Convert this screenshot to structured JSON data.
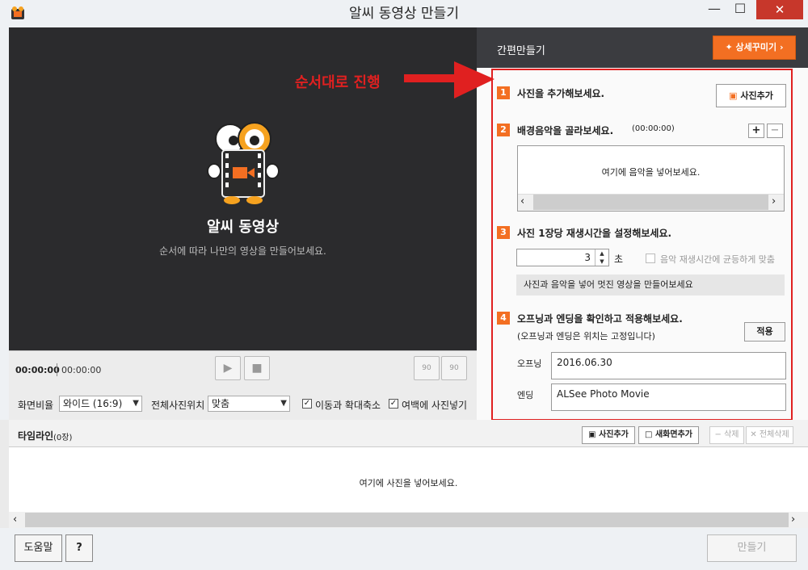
{
  "window": {
    "title": "알씨 동영상 만들기",
    "min": "—",
    "max": "☐",
    "close": "✕"
  },
  "preview": {
    "title": "알씨 동영상",
    "subtitle": "순서에 따라 나만의 영상을 만들어보세요."
  },
  "player": {
    "current_time": "00:00:00",
    "total_time": "00:00:00",
    "rotate_left": "90",
    "rotate_right": "90"
  },
  "options": {
    "ratio_label": "화면비율",
    "ratio_value": "와이드 (16:9)",
    "position_label": "전체사진위치",
    "position_value": "맞춤",
    "zoom_label": "이동과 확대축소",
    "zoom_checked": true,
    "margin_label": "여백에 사진넣기",
    "margin_checked": true
  },
  "panel": {
    "title": "간편만들기",
    "detail_button": "상세꾸미기"
  },
  "annotation": {
    "text": "순서대로 진행"
  },
  "steps": {
    "s1": {
      "num": "1",
      "title": "사진을 추가해보세요.",
      "button": "사진추가"
    },
    "s2": {
      "num": "2",
      "title": "배경음악을 골라보세요.",
      "time": "(00:00:00)",
      "add": "+",
      "remove": "−",
      "placeholder": "여기에 음악을 넣어보세요."
    },
    "s3": {
      "num": "3",
      "title": "사진 1장당 재생시간을 설정해보세요.",
      "seconds": "3",
      "unit": "초",
      "equal_label": "음악 재생시간에 균등하게 맞춤",
      "hint": "사진과 음악을 넣어 멋진 영상을 만들어보세요"
    },
    "s4": {
      "num": "4",
      "title": "오프닝과 엔딩을 확인하고 적용해보세요.",
      "note": "(오프닝과 엔딩은 위치는 고정입니다)",
      "apply": "적용",
      "opening_label": "오프닝",
      "opening_value": "2016.06.30",
      "ending_label": "엔딩",
      "ending_value": "ALSee Photo Movie"
    }
  },
  "timeline": {
    "title": "타임라인",
    "count": "(0장)",
    "add_photo": "사진추가",
    "add_screen": "새화면추가",
    "delete": "− 삭제",
    "delete_all": "✕ 전체삭제",
    "placeholder": "여기에 사진을 넣어보세요."
  },
  "footer": {
    "help": "도움말",
    "question": "?",
    "make": "만들기"
  },
  "colors": {
    "accent": "#f36f22",
    "annotation": "#e02020",
    "dark_bg": "#2b2b2d"
  }
}
